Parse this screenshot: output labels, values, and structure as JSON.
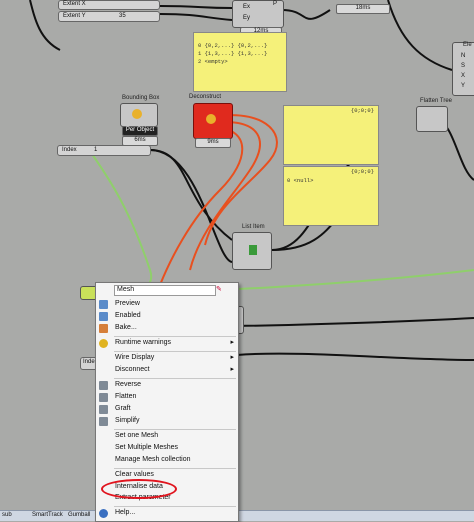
{
  "sliders": {
    "extent_x": "Extent X",
    "extent_y": "Extent Y",
    "extent_y_value": "35",
    "index_top": "Index",
    "index_top_value": "1",
    "index_bottom": "Inde"
  },
  "timers": {
    "top_mid": "12ms",
    "top_right": "18ms",
    "bbox": "6ms",
    "deconstruct": "9ms"
  },
  "components": {
    "bounding_box": "Bounding Box",
    "bounding_box_mode": "Per Object",
    "deconstruct": "Deconstruct",
    "flatten_tree": "Flatten Tree",
    "list_item": "List Item",
    "top_ports": [
      "Ex",
      "Ey",
      "P"
    ],
    "right_partial": "Ele",
    "right_ports": [
      "N",
      "S",
      "X",
      "Y"
    ]
  },
  "panels": {
    "top_line1": "0 {0,2,...}  {0,2,...}",
    "top_line2": "1 {1,3,...}  {1,3,...}",
    "top_line3": "2 <empty>",
    "mid_header": "{0;0;0}",
    "low_header": "{0;0;0}",
    "low_line": "0 <null>"
  },
  "context_menu": {
    "name_value": "Mesh",
    "items": [
      {
        "label": "Preview",
        "icon": "preview-icon"
      },
      {
        "label": "Enabled",
        "icon": "enabled-icon"
      },
      {
        "label": "Bake...",
        "icon": "bake-icon"
      },
      {
        "label": "Runtime warnings",
        "icon": "warning-icon",
        "submenu": true
      },
      {
        "label": "Wire Display",
        "submenu": true
      },
      {
        "label": "Disconnect",
        "submenu": true
      },
      {
        "label": "Reverse",
        "icon": "reverse-icon"
      },
      {
        "label": "Flatten",
        "icon": "flatten-icon"
      },
      {
        "label": "Graft",
        "icon": "graft-icon"
      },
      {
        "label": "Simplify",
        "icon": "simplify-icon"
      },
      {
        "label": "Set one Mesh"
      },
      {
        "label": "Set Multiple Meshes"
      },
      {
        "label": "Manage Mesh collection"
      },
      {
        "label": "Clear values"
      },
      {
        "label": "Internalise data"
      },
      {
        "label": "Extract parameter"
      },
      {
        "label": "Help...",
        "icon": "help-icon"
      }
    ]
  },
  "taskbar": {
    "left": "sub",
    "item1": "SmartTrack",
    "item2": "Gumball"
  },
  "colors": {
    "canvas": "#a9aaa8",
    "panel_yellow": "#f5f17a",
    "wire_orange": "#e8501f",
    "wire_green": "#8fcf6b",
    "highlight_circle": "#e0141e"
  }
}
